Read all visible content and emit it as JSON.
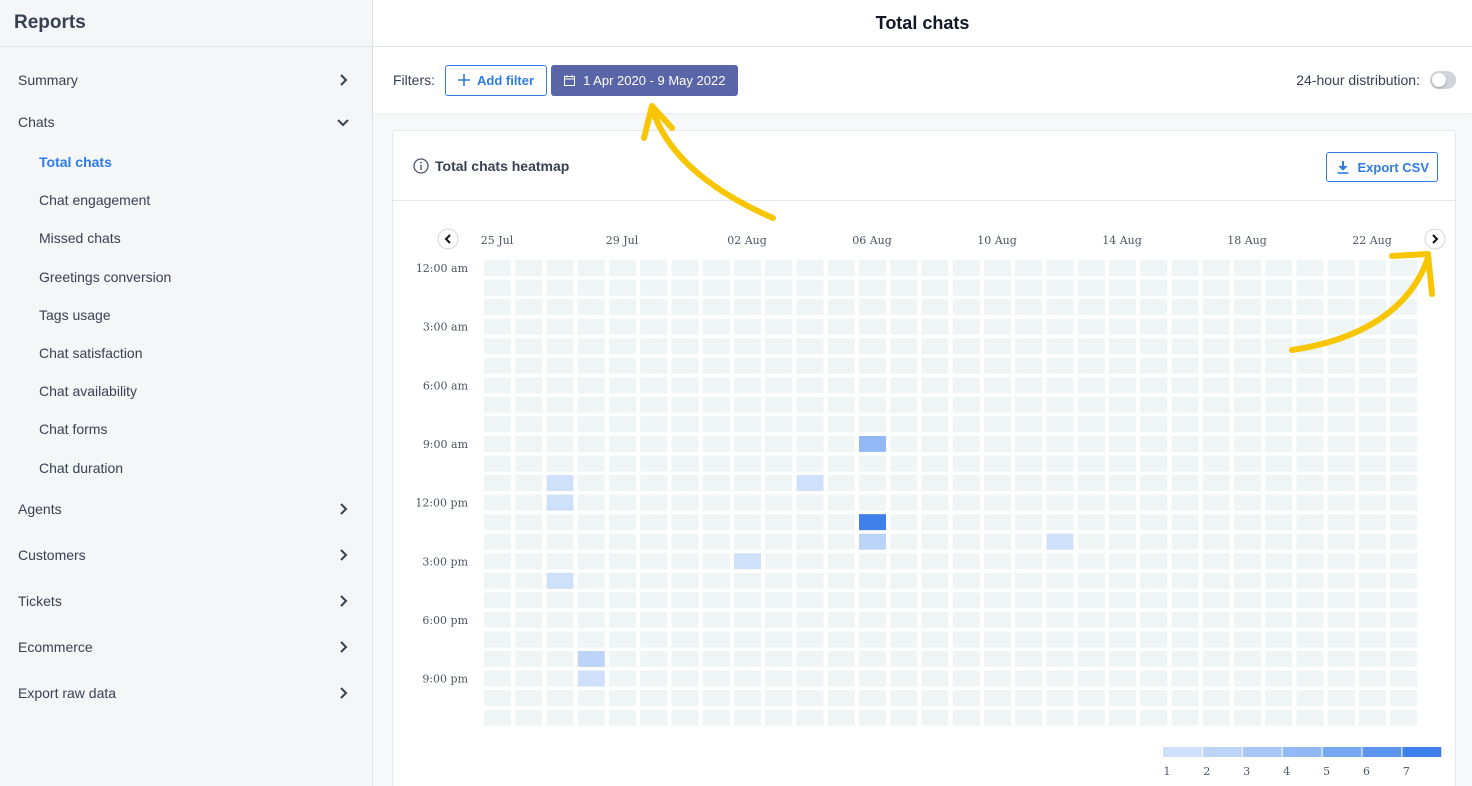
{
  "sidebar": {
    "title": "Reports",
    "items": [
      {
        "label": "Summary",
        "chevron": "right"
      },
      {
        "label": "Chats",
        "chevron": "down",
        "children": [
          {
            "label": "Total chats",
            "active": true
          },
          {
            "label": "Chat engagement"
          },
          {
            "label": "Missed chats"
          },
          {
            "label": "Greetings conversion"
          },
          {
            "label": "Tags usage"
          },
          {
            "label": "Chat satisfaction"
          },
          {
            "label": "Chat availability"
          },
          {
            "label": "Chat forms"
          },
          {
            "label": "Chat duration"
          }
        ]
      },
      {
        "label": "Agents",
        "chevron": "right"
      },
      {
        "label": "Customers",
        "chevron": "right"
      },
      {
        "label": "Tickets",
        "chevron": "right"
      },
      {
        "label": "Ecommerce",
        "chevron": "right"
      },
      {
        "label": "Export raw data",
        "chevron": "right"
      }
    ]
  },
  "header": {
    "title": "Total chats"
  },
  "filters": {
    "label": "Filters:",
    "add_filter": "Add filter",
    "date_range": "1 Apr 2020 - 9 May 2022",
    "distribution_label": "24-hour distribution:",
    "distribution_on": false
  },
  "card": {
    "title": "Total chats heatmap",
    "export_label": "Export CSV"
  },
  "colors": {
    "accent": "#2f7be8",
    "date_button": "#5965a6",
    "empty_cell": "#eff4f5",
    "annotation": "#f7c600"
  },
  "chart_data": {
    "type": "heatmap",
    "title": "Total chats heatmap",
    "x_tick_labels": [
      "25 Jul",
      "29 Jul",
      "02 Aug",
      "06 Aug",
      "10 Aug",
      "14 Aug",
      "18 Aug",
      "22 Aug"
    ],
    "x_tick_every": 4,
    "columns": 30,
    "rows": 24,
    "y_tick_labels": [
      "12:00 am",
      "3:00 am",
      "6:00 am",
      "9:00 am",
      "12:00 pm",
      "3:00 pm",
      "6:00 pm",
      "9:00 pm"
    ],
    "y_tick_every": 3,
    "cells": [
      {
        "day": 12,
        "hour": 9,
        "value": 4
      },
      {
        "day": 2,
        "hour": 11,
        "value": 1
      },
      {
        "day": 10,
        "hour": 11,
        "value": 1
      },
      {
        "day": 2,
        "hour": 12,
        "value": 1
      },
      {
        "day": 12,
        "hour": 13,
        "value": 7
      },
      {
        "day": 12,
        "hour": 14,
        "value": 2
      },
      {
        "day": 18,
        "hour": 14,
        "value": 1
      },
      {
        "day": 8,
        "hour": 15,
        "value": 1
      },
      {
        "day": 2,
        "hour": 16,
        "value": 1
      },
      {
        "day": 3,
        "hour": 20,
        "value": 2
      },
      {
        "day": 3,
        "hour": 21,
        "value": 1
      }
    ],
    "legend": {
      "labels": [
        "1",
        "2",
        "3",
        "4",
        "5",
        "6",
        "7"
      ],
      "colors": [
        "#cfe0fb",
        "#bdd4f9",
        "#a8c7f7",
        "#92b8f5",
        "#78a7f2",
        "#5e95ee",
        "#4080ea"
      ]
    }
  }
}
